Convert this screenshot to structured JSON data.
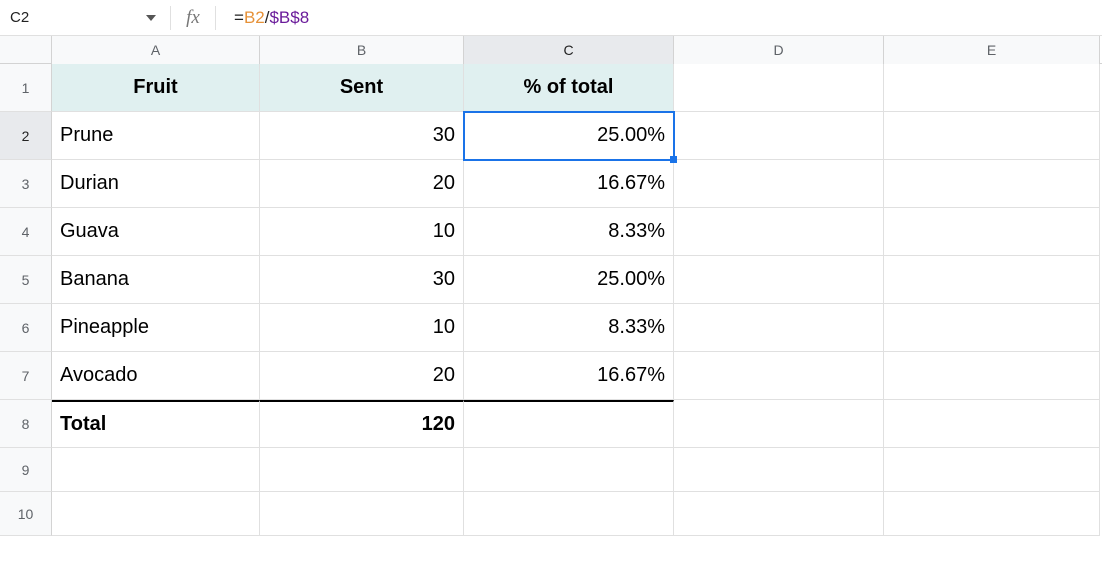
{
  "nameBox": "C2",
  "formula": {
    "eq": "=",
    "ref1": "B2",
    "slash": "/",
    "ref2": "$B$8"
  },
  "cols": {
    "A": "A",
    "B": "B",
    "C": "C",
    "D": "D",
    "E": "E"
  },
  "selectedCol": "C",
  "selectedRow": "2",
  "rows": [
    "1",
    "2",
    "3",
    "4",
    "5",
    "6",
    "7",
    "8",
    "9",
    "10"
  ],
  "headers": {
    "A": "Fruit",
    "B": "Sent",
    "C": "% of total"
  },
  "data": [
    {
      "A": "Prune",
      "B": "30",
      "C": "25.00%"
    },
    {
      "A": "Durian",
      "B": "20",
      "C": "16.67%"
    },
    {
      "A": "Guava",
      "B": "10",
      "C": "8.33%"
    },
    {
      "A": "Banana",
      "B": "30",
      "C": "25.00%"
    },
    {
      "A": "Pineapple",
      "B": "10",
      "C": "8.33%"
    },
    {
      "A": "Avocado",
      "B": "20",
      "C": "16.67%"
    }
  ],
  "totalRow": {
    "A": "Total",
    "B": "120",
    "C": ""
  }
}
